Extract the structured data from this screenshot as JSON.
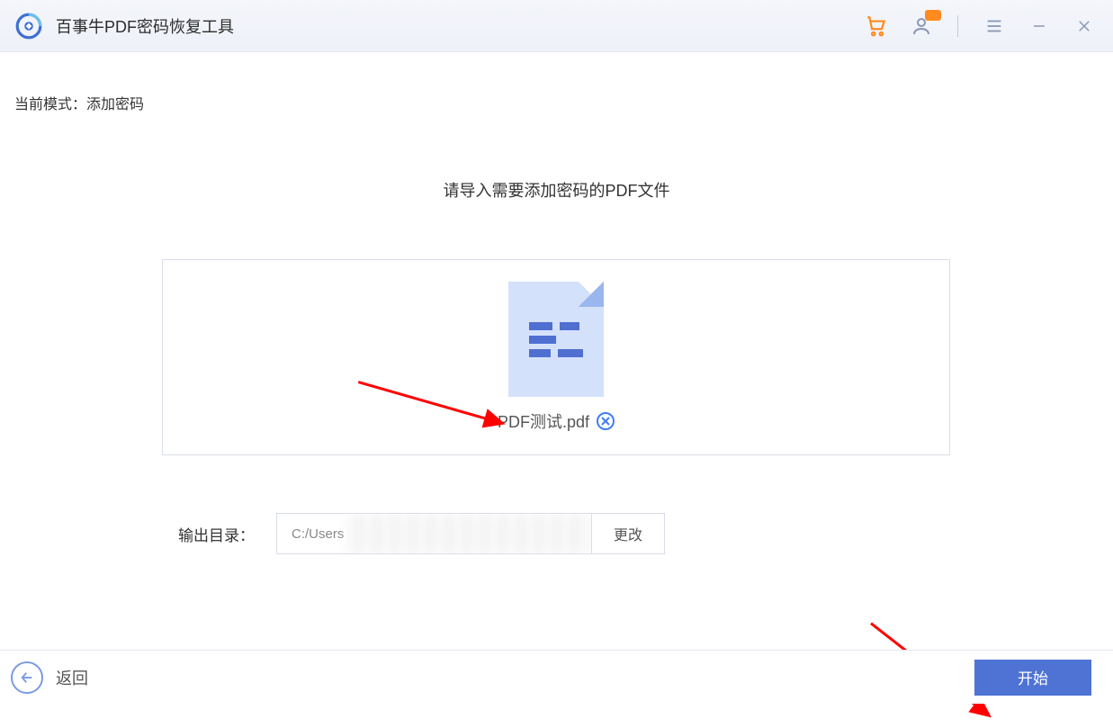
{
  "titlebar": {
    "app_title": "百事牛PDF密码恢复工具"
  },
  "main": {
    "mode_label": "当前模式：",
    "mode_value": "添加密码",
    "instruction": "请导入需要添加密码的PDF文件",
    "file_name": "PDF测试.pdf",
    "output_label": "输出目录：",
    "output_path_visible": "C:/Users",
    "change_button": "更改"
  },
  "bottom": {
    "back_label": "返回",
    "start_label": "开始"
  },
  "colors": {
    "accent": "#4e73d4",
    "arrow": "#ff0000"
  }
}
